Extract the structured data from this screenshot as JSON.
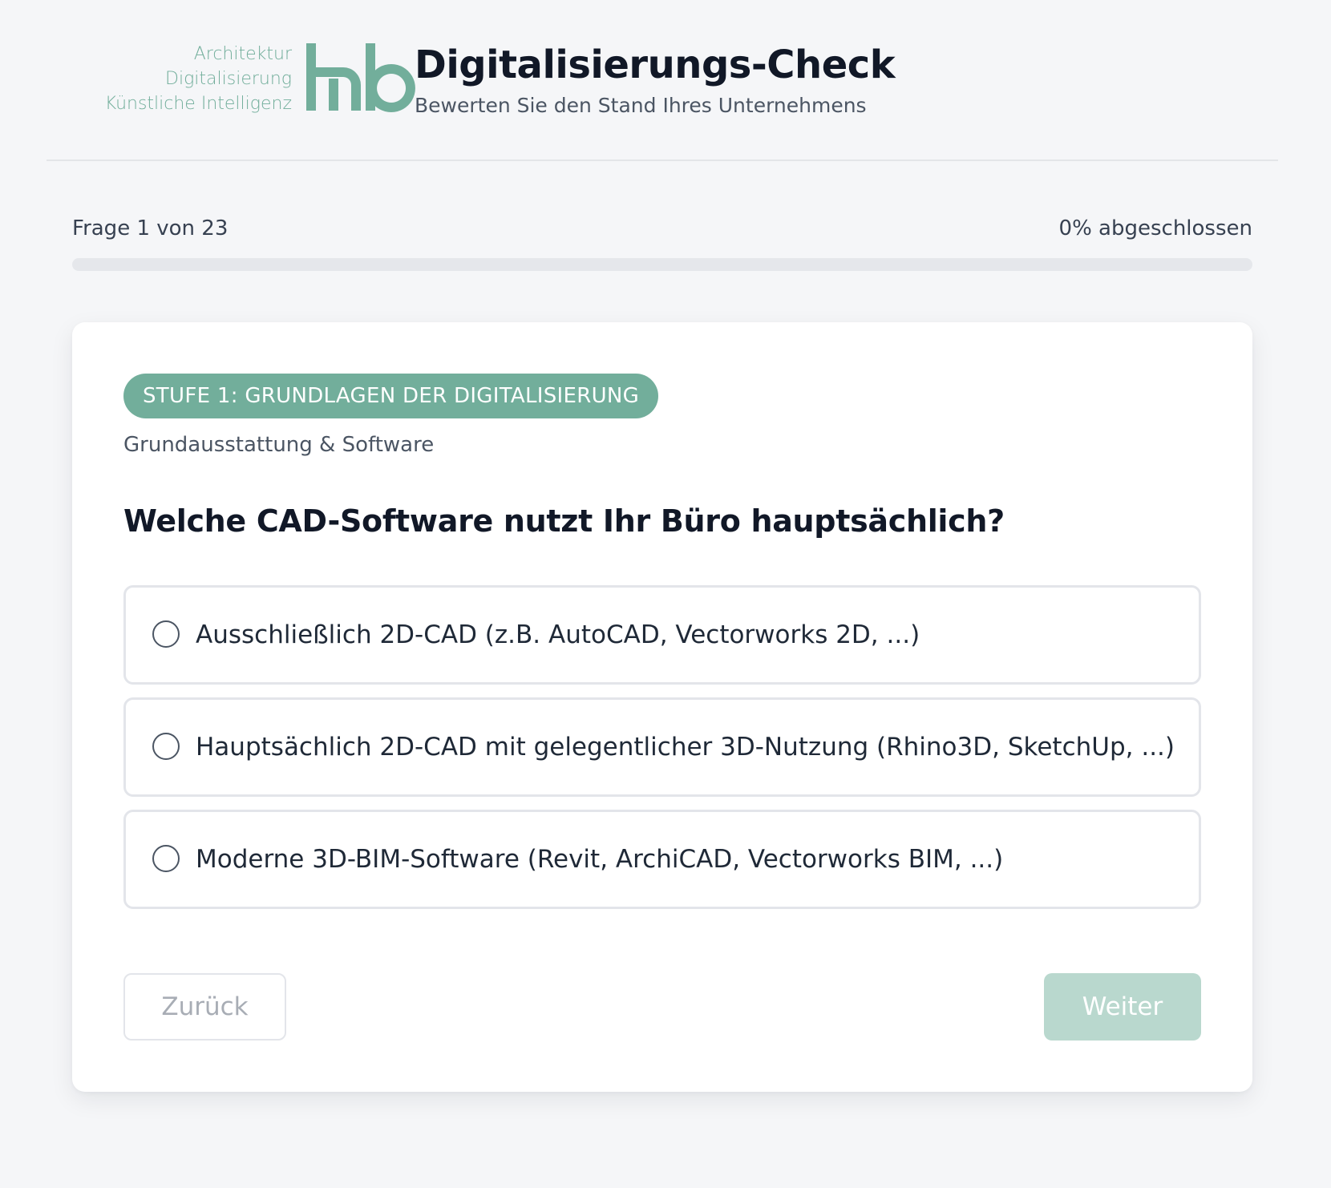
{
  "header": {
    "logo_lines": [
      "Architektur",
      "Digitalisierung",
      "Künstliche Intelligenz"
    ],
    "logo_mark": "hb",
    "title": "Digitalisierungs-Check",
    "subtitle": "Bewerten Sie den Stand Ihres Unternehmens"
  },
  "progress": {
    "question_counter": "Frage 1 von 23",
    "percent_label": "0% abgeschlossen",
    "fraction": 0
  },
  "card": {
    "stage_badge": "STUFE 1: GRUNDLAGEN DER DIGITALISIERUNG",
    "category": "Grundausstattung & Software",
    "question": "Welche CAD-Software nutzt Ihr Büro hauptsächlich?",
    "options": [
      {
        "label": "Ausschließlich 2D-CAD (z.B. AutoCAD, Vectorworks 2D, ...)",
        "selected": false
      },
      {
        "label": "Hauptsächlich 2D-CAD mit gelegentlicher 3D-Nutzung (Rhino3D, SketchUp, ...)",
        "selected": false
      },
      {
        "label": "Moderne 3D-BIM-Software (Revit, ArchiCAD, Vectorworks BIM, ...)",
        "selected": false
      }
    ],
    "back_label": "Zurück",
    "next_label": "Weiter"
  },
  "colors": {
    "accent": "#72ae9b",
    "accent_disabled": "#b9d8ce",
    "background": "#f5f6f8",
    "text_primary": "#111827"
  },
  "icons": [
    "logo-mark",
    "radio-icon"
  ]
}
